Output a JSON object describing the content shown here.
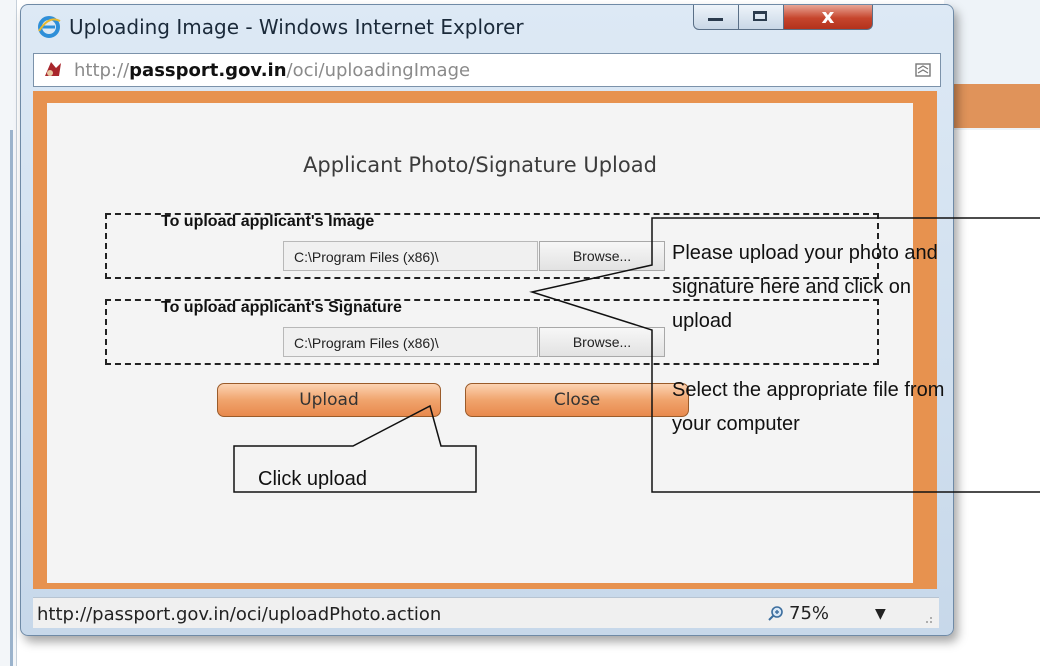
{
  "window": {
    "title": "Uploading Image - Windows Internet Explorer",
    "close_glyph": "x"
  },
  "address": {
    "url_prefix": "http://",
    "url_domain": "passport.gov.in",
    "url_path": "/oci/uploadingImage"
  },
  "page": {
    "heading": "Applicant Photo/Signature Upload",
    "image_section": {
      "label": "To upload applicant's Image",
      "file_value": "C:\\Program Files (x86)\\",
      "browse_label": "Browse..."
    },
    "signature_section": {
      "label": "To upload applicant's Signature",
      "file_value": "C:\\Program Files (x86)\\",
      "browse_label": "Browse..."
    },
    "upload_label": "Upload",
    "close_label": "Close"
  },
  "status": {
    "url": "http://passport.gov.in/oci/uploadPhoto.action",
    "zoom": "75%"
  },
  "callouts": {
    "upload_note": "Click upload",
    "photo_note_lines": [
      "Please upload your photo and",
      "signature here and click on",
      "upload"
    ],
    "file_note_lines": [
      "Select the appropriate file from",
      "your computer"
    ]
  },
  "colors": {
    "accent_orange": "#e7924f",
    "button_orange": "#f0a46d",
    "close_red": "#c6452d"
  },
  "icons": {
    "browser": "internet-explorer-icon",
    "page": "page-favicon-icon",
    "compat": "compatibility-view-icon",
    "zoom": "zoom-magnifier-icon"
  }
}
